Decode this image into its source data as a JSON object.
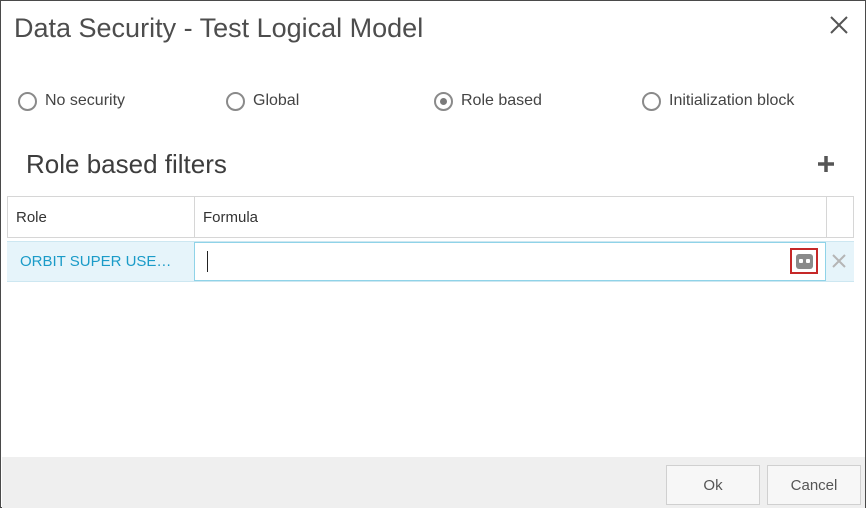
{
  "dialog": {
    "title": "Data Security - Test Logical Model"
  },
  "security_options": [
    {
      "label": "No security",
      "checked": false
    },
    {
      "label": "Global",
      "checked": false
    },
    {
      "label": "Role based",
      "checked": true
    },
    {
      "label": "Initialization block",
      "checked": false
    }
  ],
  "filters": {
    "title": "Role based filters",
    "columns": {
      "role": "Role",
      "formula": "Formula"
    },
    "rows": [
      {
        "role": "ORBIT SUPER USE…",
        "formula": ""
      }
    ]
  },
  "footer": {
    "ok_label": "Ok",
    "cancel_label": "Cancel"
  },
  "colors": {
    "link": "#1a9bc8",
    "row_selected": "#e6f4fa",
    "highlight_box": "#c62828"
  }
}
